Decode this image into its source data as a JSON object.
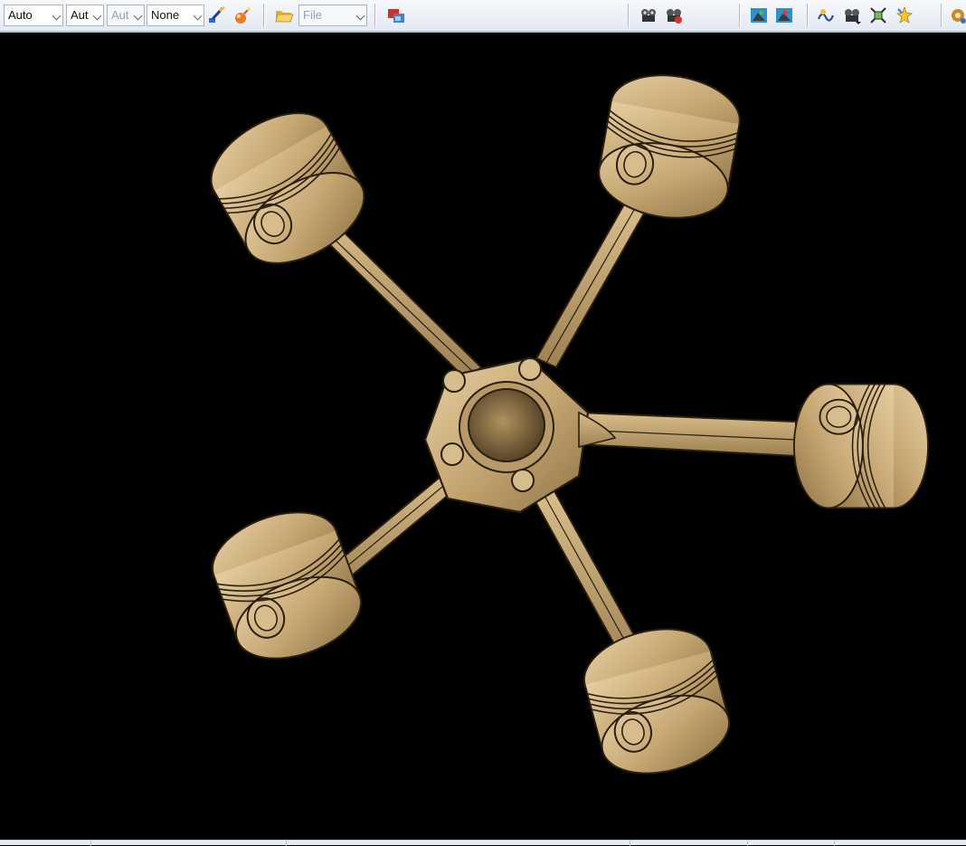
{
  "toolbar": {
    "combo_color": "Auto",
    "combo_linetype": "Aut",
    "combo_thickness": "Aut",
    "combo_layer": "None",
    "file_combo": "File",
    "icons": [
      "painter-icon",
      "magic-wand-icon",
      "folder-open-icon",
      "catalog-icon",
      "simulation-icon",
      "simulation-run-icon",
      "swap-view-icon",
      "compare-view-icon",
      "clash-icon",
      "analysis-icon",
      "fit-all-icon",
      "sparkle-icon",
      "settings-icon"
    ]
  },
  "colors": {
    "model": "#c9ac7c",
    "model_shadow": "#6f5a37",
    "background": "#000000",
    "toolbar": "#e8edf4"
  }
}
